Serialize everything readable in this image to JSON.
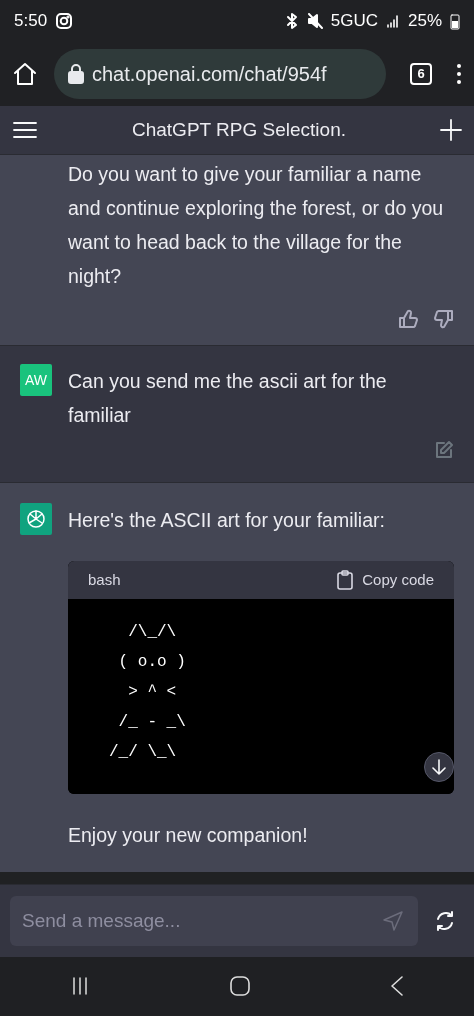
{
  "status_bar": {
    "time": "5:50",
    "network": "5GUC",
    "battery": "25%"
  },
  "browser": {
    "url": "chat.openai.com/chat/954f",
    "tab_count": "6"
  },
  "header": {
    "title": "ChatGPT RPG Selection."
  },
  "messages": [
    {
      "kind": "assistant",
      "show_avatar": false,
      "text": "Do you want to give your familiar a name and continue exploring the forest, or do you want to head back to the village for the night?",
      "feedback": true
    },
    {
      "kind": "user",
      "avatar": "AW",
      "text": "Can you send me the ascii art for the familiar"
    },
    {
      "kind": "assistant",
      "show_avatar": true,
      "text": "Here's the ASCII art for your familiar:",
      "code": {
        "language": "bash",
        "copy_label": "Copy code",
        "lines": [
          "  /\\_/\\",
          " ( o.o )",
          "  > ^ <",
          " /_ - _\\",
          "/_/ \\_\\"
        ]
      },
      "after": "Enjoy your new companion!",
      "feedback": false
    }
  ],
  "composer": {
    "placeholder": "Send a message..."
  }
}
